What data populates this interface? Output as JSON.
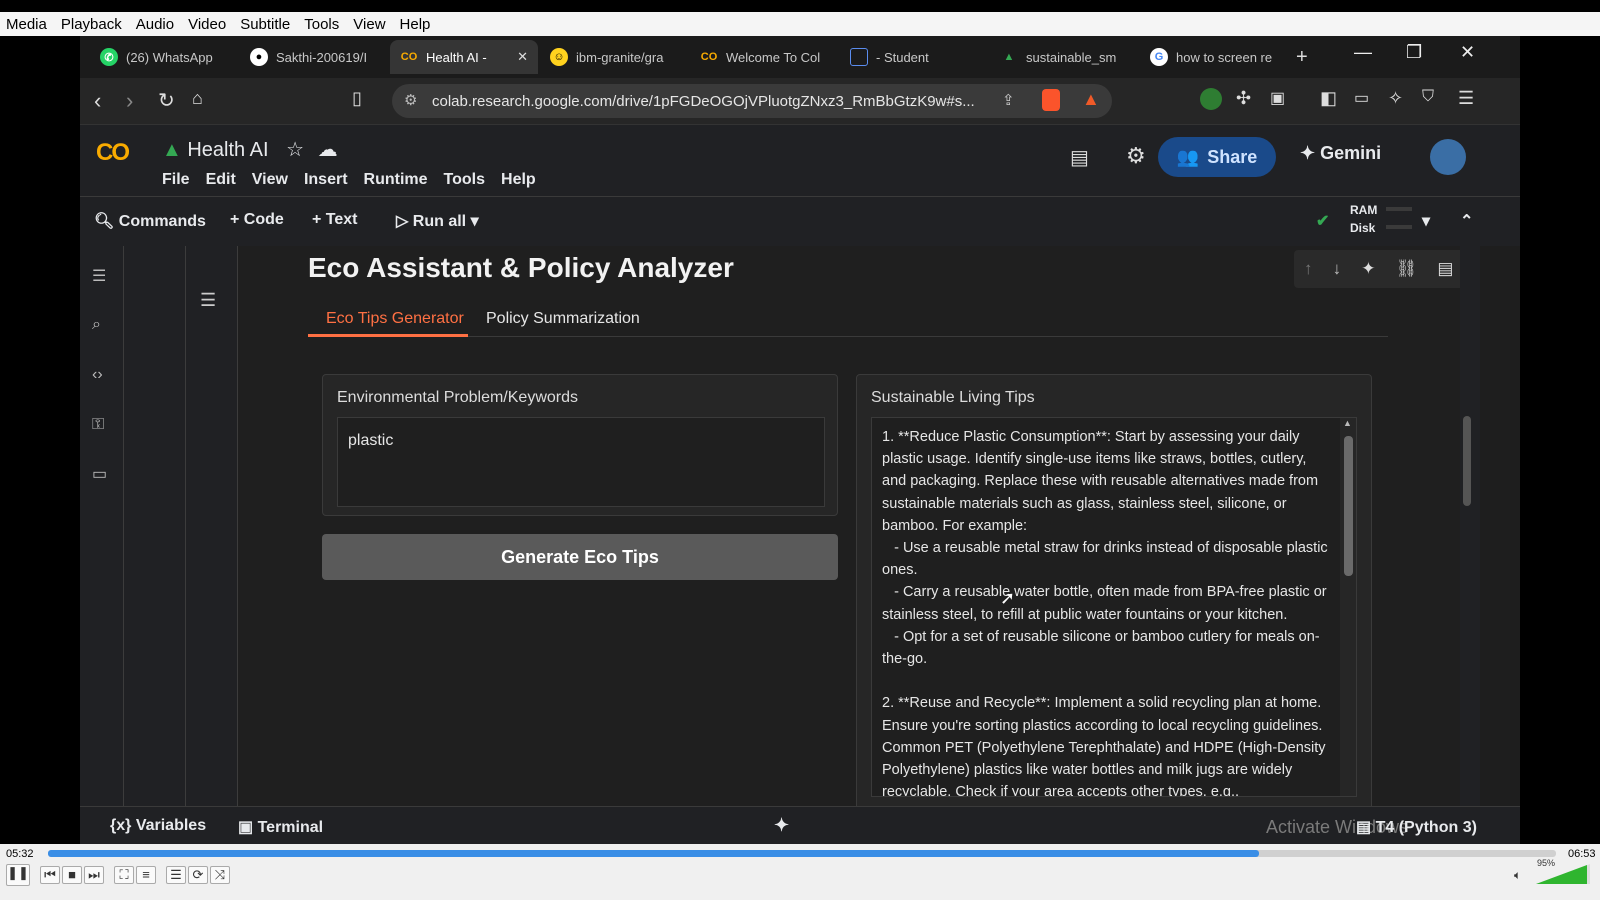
{
  "vlc": {
    "menu": [
      "Media",
      "Playback",
      "Audio",
      "Video",
      "Subtitle",
      "Tools",
      "View",
      "Help"
    ],
    "time_current": "05:32",
    "time_total": "06:53",
    "progress": 0.803,
    "volume": "95%"
  },
  "browser": {
    "tabs": [
      {
        "label": "(26) WhatsApp",
        "icon": "whatsapp-icon"
      },
      {
        "label": "Sakthi-200619/I",
        "icon": "github-icon"
      },
      {
        "label": "Health AI - ",
        "icon": "colab-icon",
        "active": true
      },
      {
        "label": "ibm-granite/gra",
        "icon": "huggingface-icon"
      },
      {
        "label": "Welcome To Col",
        "icon": "colab-icon"
      },
      {
        "label": "- Student",
        "icon": "student-icon"
      },
      {
        "label": "sustainable_sm",
        "icon": "drive-icon"
      },
      {
        "label": "how to screen re",
        "icon": "google-icon"
      }
    ],
    "url": "colab.research.google.com/drive/1pFGDeOGOjVPluotgZNxz3_RmBbGtzK9w#s..."
  },
  "colab": {
    "logo": "CO",
    "notebook_title": "Health AI",
    "menus": [
      "File",
      "Edit",
      "View",
      "Insert",
      "Runtime",
      "Tools",
      "Help"
    ],
    "share_label": "Share",
    "gemini_label": "Gemini",
    "toolbar": {
      "commands": "Commands",
      "code": "+ Code",
      "text": "+ Text",
      "run_all": "Run all"
    },
    "ram_label": "RAM",
    "disk_label": "Disk",
    "status": {
      "variables": "Variables",
      "terminal": "Terminal",
      "runtime": "T4 (Python 3)",
      "watermark": "Activate Windows"
    }
  },
  "app": {
    "title": "Eco Assistant & Policy Analyzer",
    "tabs": [
      "Eco Tips Generator",
      "Policy Summarization"
    ],
    "input_label": "Environmental Problem/Keywords",
    "input_value": "plastic",
    "button_label": "Generate Eco Tips",
    "output_label": "Sustainable Living Tips",
    "output_text": "1. **Reduce Plastic Consumption**: Start by assessing your daily plastic usage. Identify single-use items like straws, bottles, cutlery, and packaging. Replace these with reusable alternatives made from sustainable materials such as glass, stainless steel, silicone, or bamboo. For example:\n   - Use a reusable metal straw for drinks instead of disposable plastic ones.\n   - Carry a reusable water bottle, often made from BPA-free plastic or stainless steel, to refill at public water fountains or your kitchen.\n   - Opt for a set of reusable silicone or bamboo cutlery for meals on-the-go.\n\n2. **Reuse and Recycle**: Implement a solid recycling plan at home. Ensure you're sorting plastics according to local recycling guidelines. Common PET (Polyethylene Terephthalate) and HDPE (High-Density Polyethylene) plastics like water bottles and milk jugs are widely recyclable. Check if your area accepts other types, e.g.,"
  },
  "colors": {
    "accent": "#ff7043",
    "share_bg": "#1a4a8a",
    "seek": "#3a8ee6"
  }
}
